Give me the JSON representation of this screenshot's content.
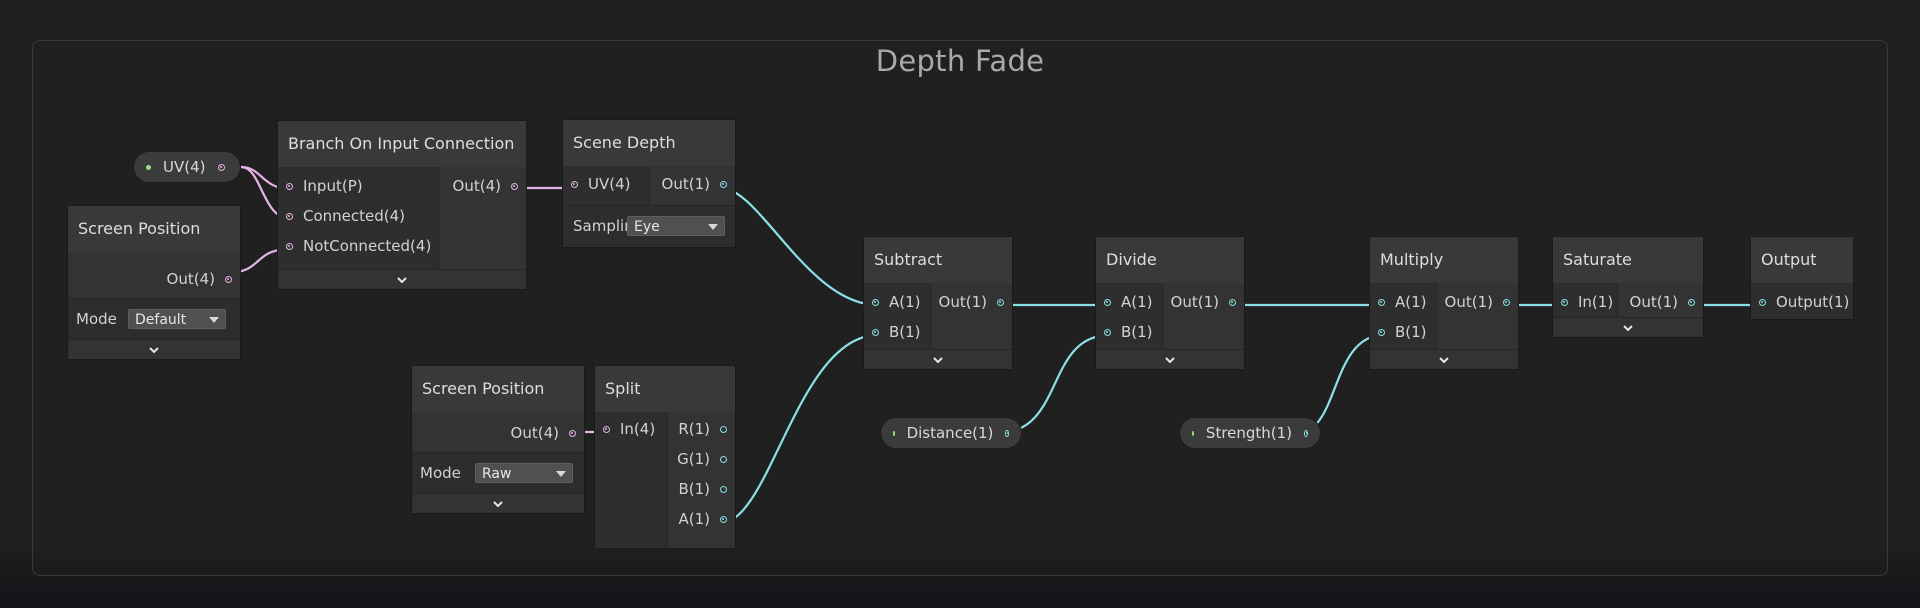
{
  "graph": {
    "title": "Depth Fade"
  },
  "properties": [
    {
      "id": "uv",
      "label": "UV(4)"
    },
    {
      "id": "distance",
      "label": "Distance(1)"
    },
    {
      "id": "strength",
      "label": "Strength(1)"
    }
  ],
  "nodes": {
    "screen_position_1": {
      "title": "Screen Position",
      "out": "Out(4)",
      "mode_label": "Mode",
      "mode_value": "Default"
    },
    "branch": {
      "title": "Branch On Input Connection",
      "in1": "Input(P)",
      "in2": "Connected(4)",
      "in3": "NotConnected(4)",
      "out": "Out(4)"
    },
    "scene_depth": {
      "title": "Scene Depth",
      "in1": "UV(4)",
      "out": "Out(1)",
      "sampling_label": "Samplin",
      "sampling_value": "Eye"
    },
    "screen_position_2": {
      "title": "Screen Position",
      "out": "Out(4)",
      "mode_label": "Mode",
      "mode_value": "Raw"
    },
    "split": {
      "title": "Split",
      "in1": "In(4)",
      "out1": "R(1)",
      "out2": "G(1)",
      "out3": "B(1)",
      "out4": "A(1)"
    },
    "subtract": {
      "title": "Subtract",
      "in1": "A(1)",
      "in2": "B(1)",
      "out": "Out(1)"
    },
    "divide": {
      "title": "Divide",
      "in1": "A(1)",
      "in2": "B(1)",
      "out": "Out(1)"
    },
    "multiply": {
      "title": "Multiply",
      "in1": "A(1)",
      "in2": "B(1)",
      "out": "Out(1)"
    },
    "saturate": {
      "title": "Saturate",
      "in1": "In(1)",
      "out": "Out(1)"
    },
    "output": {
      "title": "Output",
      "in1": "Output(1)"
    }
  },
  "icons": {
    "expand": "chevron-down-icon",
    "dropdown": "caret-down-icon"
  },
  "colors": {
    "vector_wire": "#e6b3e6",
    "float_wire": "#8ae0e6",
    "property_dot": "#9cdf7f",
    "background": "#202020"
  }
}
